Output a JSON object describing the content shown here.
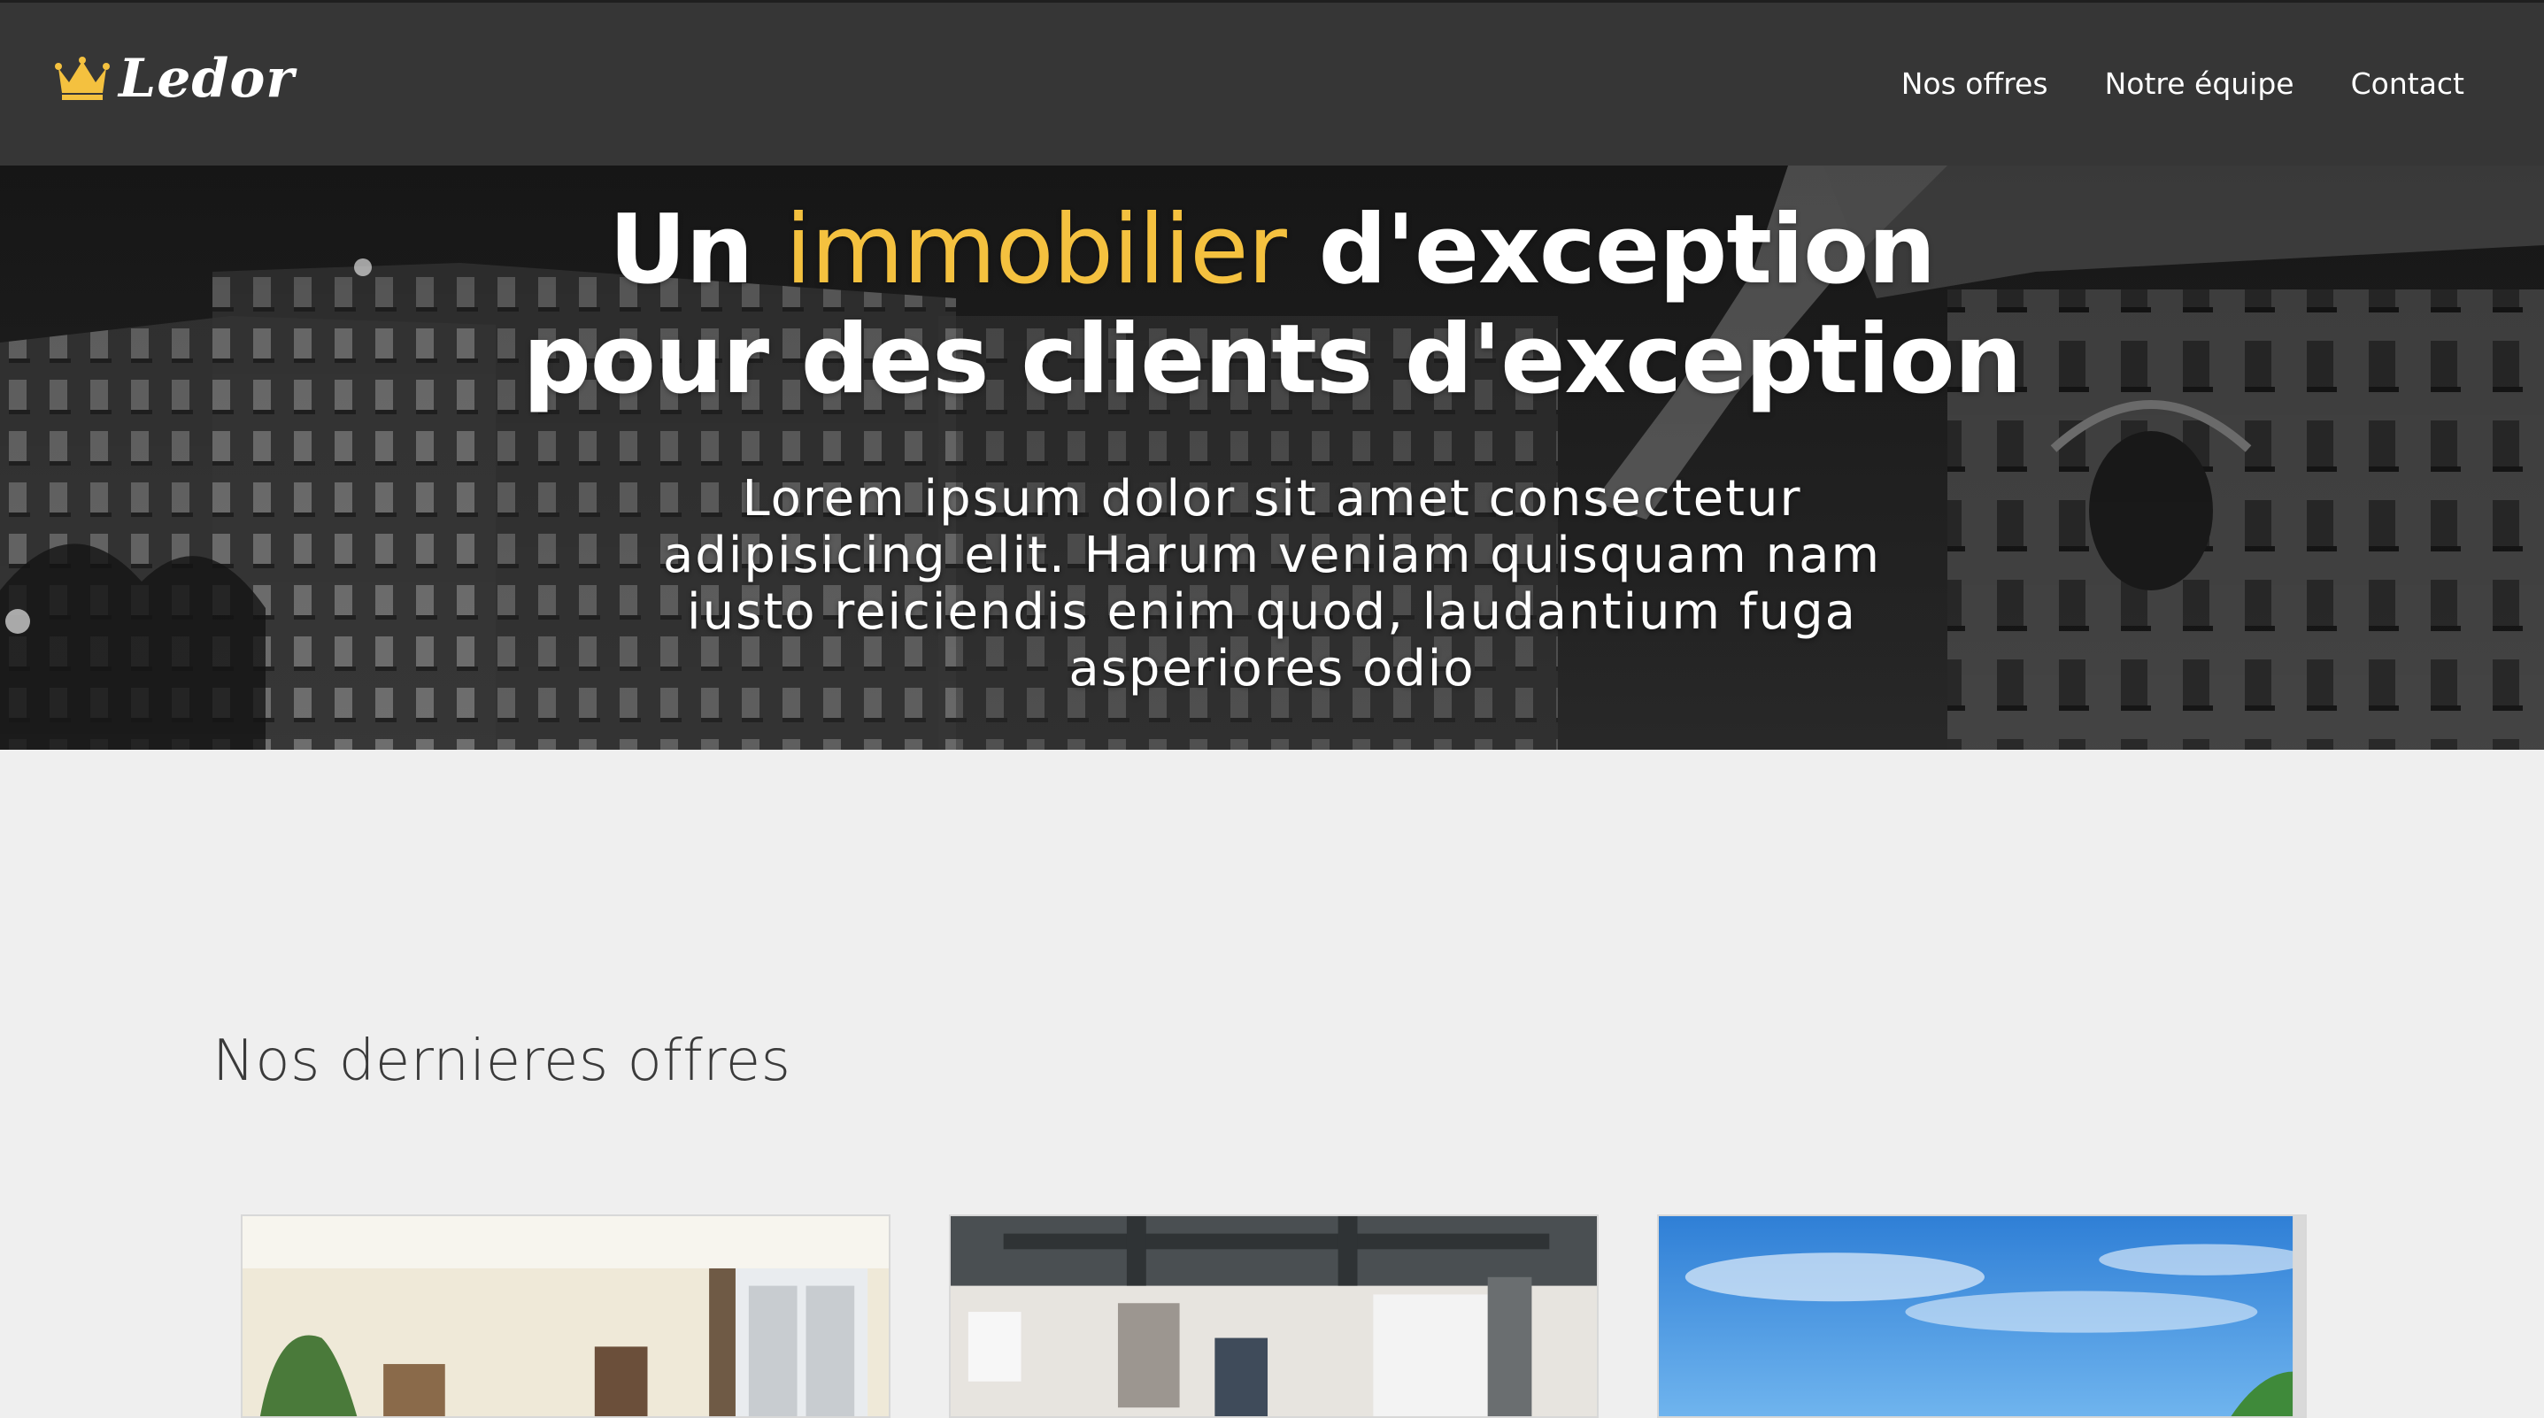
{
  "brand": {
    "name": "Ledor",
    "icon": "crown-icon",
    "accent_color": "#f4c13f"
  },
  "nav": {
    "items": [
      {
        "label": "Nos offres"
      },
      {
        "label": "Notre équipe"
      },
      {
        "label": "Contact"
      }
    ]
  },
  "hero": {
    "title_before": "Un",
    "title_accent": "immobilier",
    "title_after": "d'exception",
    "title_line2": "pour des clients d'exception",
    "subtitle": "Lorem ipsum dolor sit amet consectetur adipisicing elit. Harum veniam quisquam nam iusto reiciendis enim quod, laudantium fuga asperiores odio"
  },
  "offers": {
    "title": "Nos dernieres offres",
    "cards": [
      {
        "image": "living-room-photo"
      },
      {
        "image": "loft-interior-photo"
      },
      {
        "image": "paris-sky-photo"
      }
    ]
  }
}
